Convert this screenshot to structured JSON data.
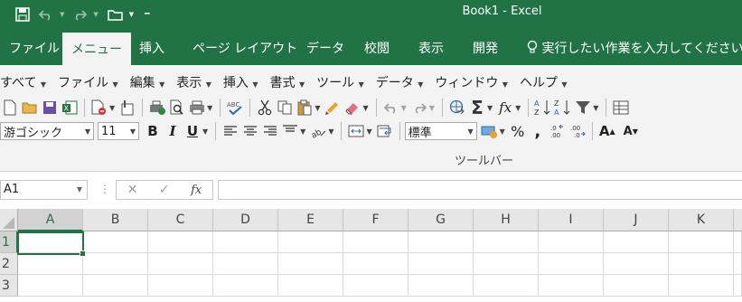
{
  "window": {
    "title": "Book1 - Excel"
  },
  "qat": {
    "icons": [
      "save-icon",
      "undo-icon",
      "redo-icon",
      "open-icon",
      "customize-qat-icon"
    ]
  },
  "tabs": [
    {
      "label": "ファイル"
    },
    {
      "label": "メニュー"
    },
    {
      "label": "挿入"
    },
    {
      "label": "ページ レイアウト"
    },
    {
      "label": "データ"
    },
    {
      "label": "校閲"
    },
    {
      "label": "表示"
    },
    {
      "label": "開発"
    }
  ],
  "tell_me": {
    "label": "実行したい作業を入力してください"
  },
  "menu": {
    "items": [
      "すべて",
      "ファイル",
      "編集",
      "表示",
      "挿入",
      "書式",
      "ツール",
      "データ",
      "ウィンドウ",
      "ヘルプ"
    ]
  },
  "format": {
    "font_name": "游ゴシック",
    "font_size": "11",
    "bold": "B",
    "italic": "I",
    "underline": "U",
    "number_format": "標準",
    "percent": "%",
    "comma": ",",
    "grow_font": "A",
    "shrink_font": "A"
  },
  "ribbon_group": {
    "label": "ツールバー"
  },
  "formula_bar": {
    "name_box": "A1",
    "cancel": "✕",
    "enter": "✓",
    "fx": "fx",
    "content": ""
  },
  "grid": {
    "columns": [
      "A",
      "B",
      "C",
      "D",
      "E",
      "F",
      "G",
      "H",
      "I",
      "J",
      "K"
    ],
    "rows": [
      "1",
      "2",
      "3"
    ],
    "active_cell": "A1"
  },
  "colors": {
    "accent": "#217346",
    "ribbon_bg": "#f3f3f3"
  }
}
